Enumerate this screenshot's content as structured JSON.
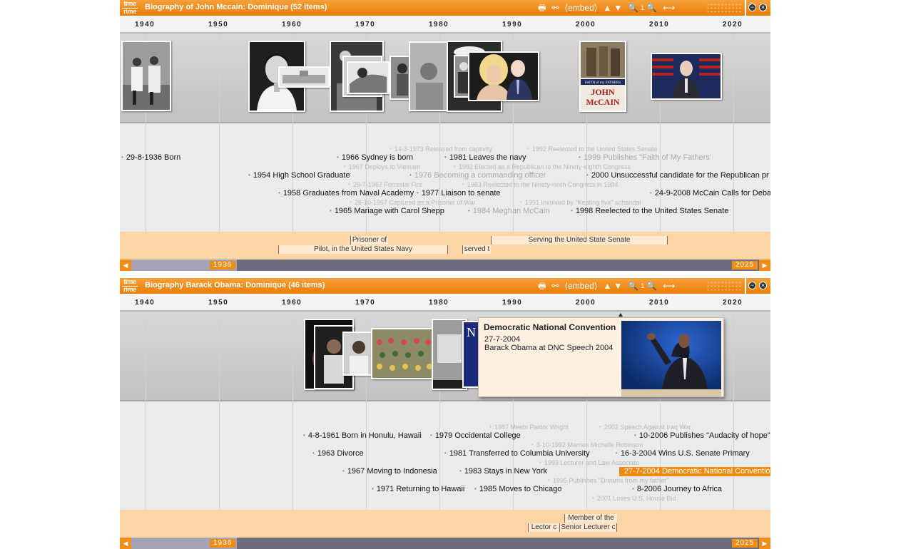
{
  "years": [
    "1940",
    "1950",
    "1960",
    "1970",
    "1980",
    "1990",
    "2000",
    "2010",
    "2020"
  ],
  "toolbar": {
    "print": "🖶",
    "link": "⚯",
    "embed": "⟨embed⟩",
    "up": "▲",
    "down": "▼",
    "zoom_in": "🔍",
    "zoom_level": "1",
    "zoom_out": "🔍",
    "fit": "⟷",
    "minimize": "−",
    "close": "×"
  },
  "logo": {
    "top": "time",
    "bottom": "rime"
  },
  "timeline1": {
    "title": "Biography of John Mccain: Dominique  (52 items)",
    "events": [
      {
        "text": "29-8-1936 Born",
        "style": ""
      },
      {
        "text": "1954 High School Graduate",
        "style": ""
      },
      {
        "text": "1958 Graduates from Naval Academy",
        "style": ""
      },
      {
        "text": "1965 Mariage with Carol Shepp",
        "style": ""
      },
      {
        "text": "1966 Sydney is born",
        "style": ""
      },
      {
        "text": "1967 Deploys to Vietnam",
        "style": "dim"
      },
      {
        "text": "29-7-1967 Forrestal Fire",
        "style": "dim"
      },
      {
        "text": "26-10-1967 Captured as a Prisoner of War",
        "style": "dim"
      },
      {
        "text": "14-3-1973 Released from captivity",
        "style": "dim"
      },
      {
        "text": "1976 Becoming a commanding officer",
        "style": "mid"
      },
      {
        "text": "1977 Liaison to senate",
        "style": ""
      },
      {
        "text": "1981 Leaves the navy",
        "style": ""
      },
      {
        "text": "1982 Elected as a Republican to the Ninety-eighth Congress",
        "style": "dim"
      },
      {
        "text": "1983 Reelected to the Ninety-ninth Congress in 1984",
        "style": "dim"
      },
      {
        "text": "1984 Meghan McCain",
        "style": "mid"
      },
      {
        "text": "1991 Involved by \"Keating five\" schandal",
        "style": "dim"
      },
      {
        "text": "1992 Reelected to the United States Senate",
        "style": "dim"
      },
      {
        "text": "1998 Reelected to the United States Senate",
        "style": ""
      },
      {
        "text": "1999 Publishes \"Faith of My Fathers'",
        "style": "mid"
      },
      {
        "text": "2000 Unsuccessful candidate for the Republican pr",
        "style": ""
      },
      {
        "text": "24-9-2008 McCain Calls for Deba",
        "style": ""
      }
    ],
    "spans": [
      "Prisoner of",
      "Pilot, in the United States Navy",
      "served t",
      "Serving the United State Senate"
    ],
    "scroll": {
      "start": "1936",
      "end": "2025"
    },
    "thumbs": [
      "naval-officers-photo",
      "young-mccain-portrait",
      "naval-academy-building",
      "family-photo",
      "vietnam-photo",
      "hospital-photo",
      "pow-photo",
      "navy-cap-photo",
      "senate-photo",
      "meghan-and-john-photo",
      "faith-of-my-fathers-book",
      "mccain-at-podium-photo"
    ],
    "book": {
      "line1": "FAITH of my FATHERS",
      "line2": "JOHN",
      "line3": "McCAIN"
    }
  },
  "timeline2": {
    "title": "Biography Barack Obama: Dominique  (46 items)",
    "events": [
      {
        "text": "4-8-1961 Born in Honulu, Hawaii",
        "style": ""
      },
      {
        "text": "1963 Divorce",
        "style": ""
      },
      {
        "text": "1967 Moving to Indonesia",
        "style": ""
      },
      {
        "text": "1971 Returning to Hawaii",
        "style": ""
      },
      {
        "text": "1979 Occidental College",
        "style": ""
      },
      {
        "text": "1981 Transferred to Columbia University",
        "style": ""
      },
      {
        "text": "1983 Stays in New York",
        "style": ""
      },
      {
        "text": "1985 Moves to Chicago",
        "style": ""
      },
      {
        "text": "1987 Meets Pastor Wright",
        "style": "dim"
      },
      {
        "text": "3-10-1992 Marries Michelle Robinson",
        "style": "dim"
      },
      {
        "text": "1993 Lecturer and Law Associate",
        "style": "dim"
      },
      {
        "text": "1995 Publishes \"Dreams from my father\"",
        "style": "dim"
      },
      {
        "text": "2001 Loses U.S. House Bid",
        "style": "dim"
      },
      {
        "text": "2002 Speech Against Iraq War",
        "style": "dim"
      },
      {
        "text": "10-2006 Publishes \"Audacity of hope\"",
        "style": ""
      },
      {
        "text": "16-3-2004 Wins U.S. Senate Primary",
        "style": ""
      },
      {
        "text": "27-7-2004 Democratic National Conventio",
        "style": "sel"
      },
      {
        "text": "8-2006 Journey to Africa",
        "style": ""
      }
    ],
    "spans": [
      "Member of the",
      "Lector c",
      "Senior Lecturer c"
    ],
    "scroll": {
      "start": "1936",
      "end": "2025"
    },
    "popup": {
      "title": "Democratic National Convention",
      "date": "27-7-2004",
      "desc": "Barack Obama at DNC Speech 2004"
    },
    "thumbs": [
      "baby-photo",
      "child-photo",
      "boy-portrait",
      "class-photo",
      "office-photo",
      "magazine-cover",
      "dnc-speech-photo"
    ],
    "magazine": "N"
  },
  "colors": {
    "accent": "#f08c18",
    "span_band": "#fdd4a5",
    "selected": "#f28a10"
  }
}
